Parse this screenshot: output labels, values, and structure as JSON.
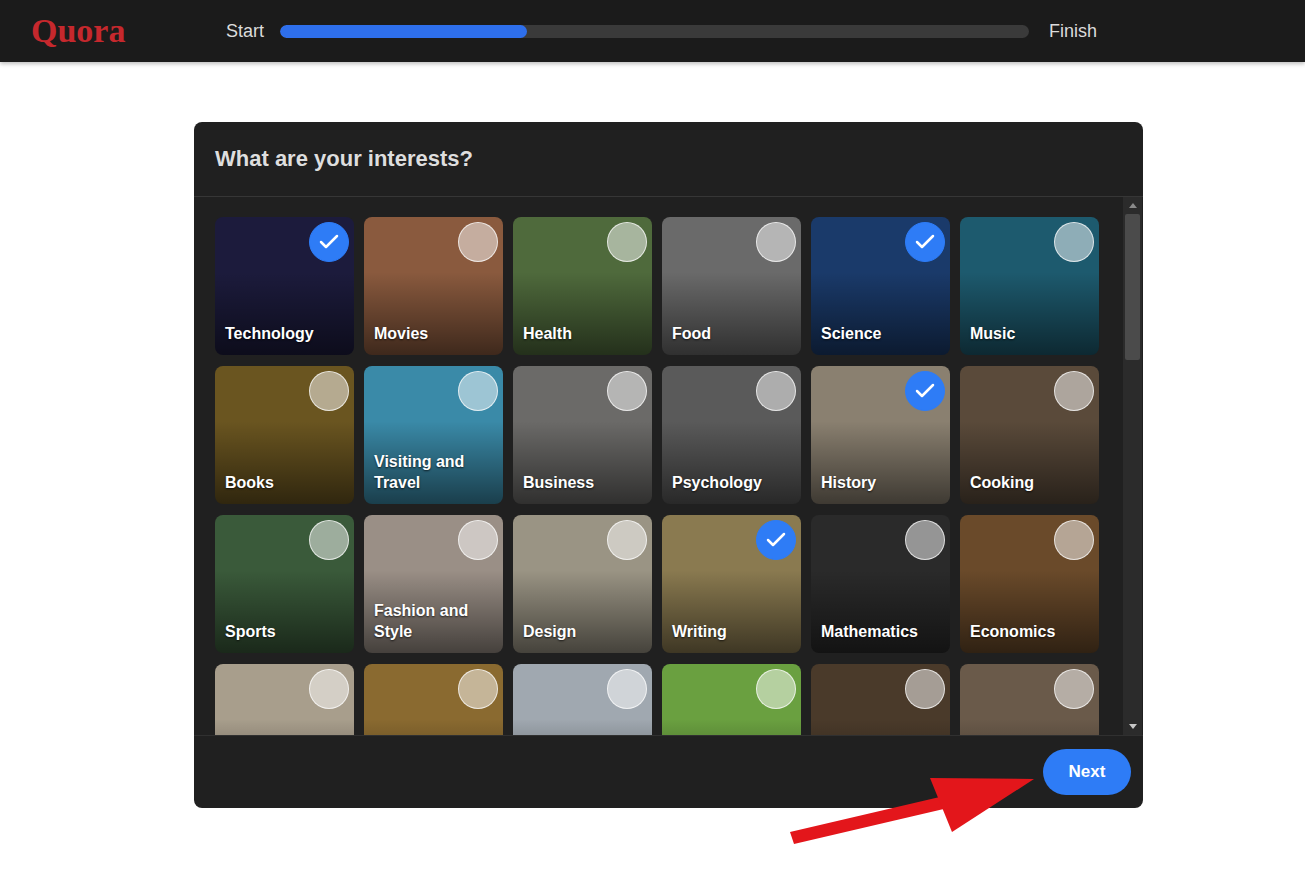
{
  "logo": "Quora",
  "progress": {
    "start": "Start",
    "finish": "Finish",
    "level": 0.33
  },
  "card": {
    "title": "What are your interests?"
  },
  "interests": [
    {
      "label": "Technology",
      "checked": true,
      "color": "#1c1b3c"
    },
    {
      "label": "Movies",
      "checked": false,
      "color": "#8a5a3e"
    },
    {
      "label": "Health",
      "checked": false,
      "color": "#4f6a3c"
    },
    {
      "label": "Food",
      "checked": false,
      "color": "#6a6a6a"
    },
    {
      "label": "Science",
      "checked": true,
      "color": "#1a3a6a"
    },
    {
      "label": "Music",
      "checked": false,
      "color": "#1d5a6e"
    },
    {
      "label": "Books",
      "checked": false,
      "color": "#6a5520"
    },
    {
      "label": "Visiting and Travel",
      "checked": false,
      "color": "#3a8aa8"
    },
    {
      "label": "Business",
      "checked": false,
      "color": "#6b6a68"
    },
    {
      "label": "Psychology",
      "checked": false,
      "color": "#5a5a5a"
    },
    {
      "label": "History",
      "checked": true,
      "color": "#8a8070"
    },
    {
      "label": "Cooking",
      "checked": false,
      "color": "#5a4a3a"
    },
    {
      "label": "Sports",
      "checked": false,
      "color": "#3a5a3a"
    },
    {
      "label": "Fashion and Style",
      "checked": false,
      "color": "#9a8f86"
    },
    {
      "label": "Design",
      "checked": false,
      "color": "#9a9484"
    },
    {
      "label": "Writing",
      "checked": true,
      "color": "#8a7a50"
    },
    {
      "label": "Mathematics",
      "checked": false,
      "color": "#2a2a2a"
    },
    {
      "label": "Economics",
      "checked": false,
      "color": "#6a4a2a"
    },
    {
      "label": "",
      "checked": false,
      "color": "#a89e8c"
    },
    {
      "label": "",
      "checked": false,
      "color": "#8a6a30"
    },
    {
      "label": "",
      "checked": false,
      "color": "#a0a8b0"
    },
    {
      "label": "",
      "checked": false,
      "color": "#6aa040"
    },
    {
      "label": "",
      "checked": false,
      "color": "#4a3a2a"
    },
    {
      "label": "",
      "checked": false,
      "color": "#6a5a4a"
    }
  ],
  "scrollbar": {
    "position": 0,
    "thumb_share": 0.29
  },
  "buttons": [
    {
      "label": "Next"
    }
  ]
}
